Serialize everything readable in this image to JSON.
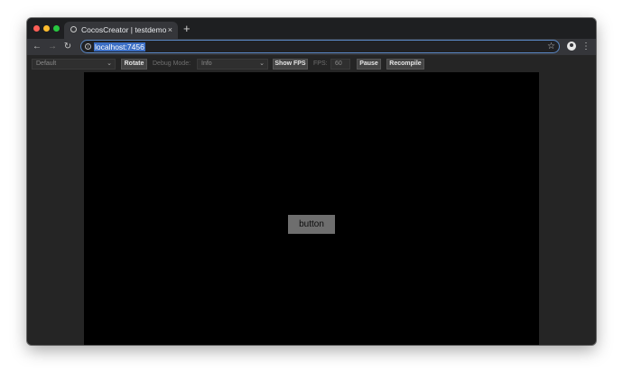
{
  "browser": {
    "tab_title": "CocosCreator | testdemo",
    "tab_close": "×",
    "new_tab": "+",
    "url": "localhost:7456",
    "nav": {
      "back": "←",
      "forward": "→",
      "reload": "↻",
      "star": "☆",
      "menu": "⋮",
      "info": "i"
    }
  },
  "toolbar": {
    "device_select": "Default",
    "rotate_label": "Rotate",
    "debug_mode_label": "Debug Mode:",
    "debug_mode_value": "Info",
    "show_fps_label": "Show FPS",
    "fps_label": "FPS:",
    "fps_value": "60",
    "pause_label": "Pause",
    "recompile_label": "Recompile",
    "chevron": "⌄"
  },
  "game": {
    "button_label": "button"
  },
  "icons": {
    "back": "back-arrow-icon",
    "forward": "forward-arrow-icon",
    "reload": "reload-icon",
    "info": "info-icon",
    "star": "star-icon",
    "profile": "profile-avatar-icon",
    "menu": "kebab-menu-icon",
    "favicon": "page-favicon-icon"
  },
  "colors": {
    "titlebar": "#1e1f21",
    "tab": "#35363a",
    "omnibox_border": "#5b89c6",
    "url_highlight": "#3b6ec4",
    "toolbar": "#252525",
    "canvas": "#000000",
    "game_button": "#6e6e6e",
    "close_dot": "#fe5f57",
    "minimize_dot": "#febc2e",
    "zoom_dot": "#28c840"
  }
}
